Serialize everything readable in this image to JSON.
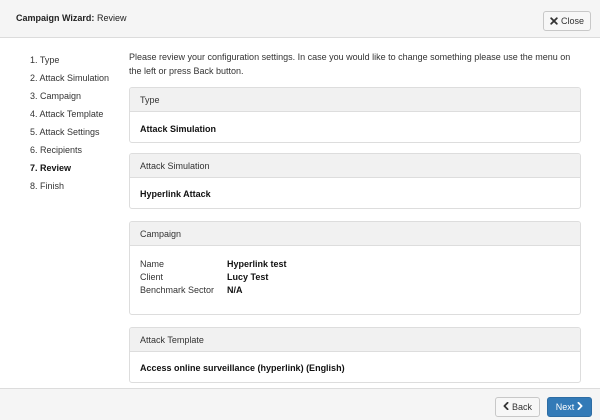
{
  "header": {
    "title_bold": "Campaign Wizard:",
    "title_rest": " Review",
    "close_label": "Close",
    "close_icon": "close-icon"
  },
  "steps": [
    "1. Type",
    "2. Attack Simulation",
    "3. Campaign",
    "4. Attack Template",
    "5. Attack Settings",
    "6. Recipients",
    "7. Review",
    "8. Finish"
  ],
  "active_step": "7. Review",
  "intro": "Please review your configuration settings. In case you would like to change something please use the menu on the left or press Back button.",
  "panels": {
    "type": {
      "heading": "Type",
      "value": "Attack Simulation"
    },
    "attack_simulation": {
      "heading": "Attack Simulation",
      "value": "Hyperlink Attack"
    },
    "campaign": {
      "heading": "Campaign",
      "rows": [
        {
          "key": "Name",
          "value": "Hyperlink test"
        },
        {
          "key": "Client",
          "value": "Lucy Test"
        },
        {
          "key": "Benchmark Sector",
          "value": "N/A"
        }
      ]
    },
    "attack_template": {
      "heading": "Attack Template",
      "value": "Access online surveillance (hyperlink) (English)"
    }
  },
  "footer": {
    "back_label": "Back",
    "next_label": "Next",
    "back_icon": "chevron-left-icon",
    "next_icon": "chevron-right-icon"
  },
  "colors": {
    "primary": "#337ab7",
    "header_bg": "#f5f5f5",
    "panel_heading_bg": "#f1f1f1",
    "border": "#dddddd"
  }
}
